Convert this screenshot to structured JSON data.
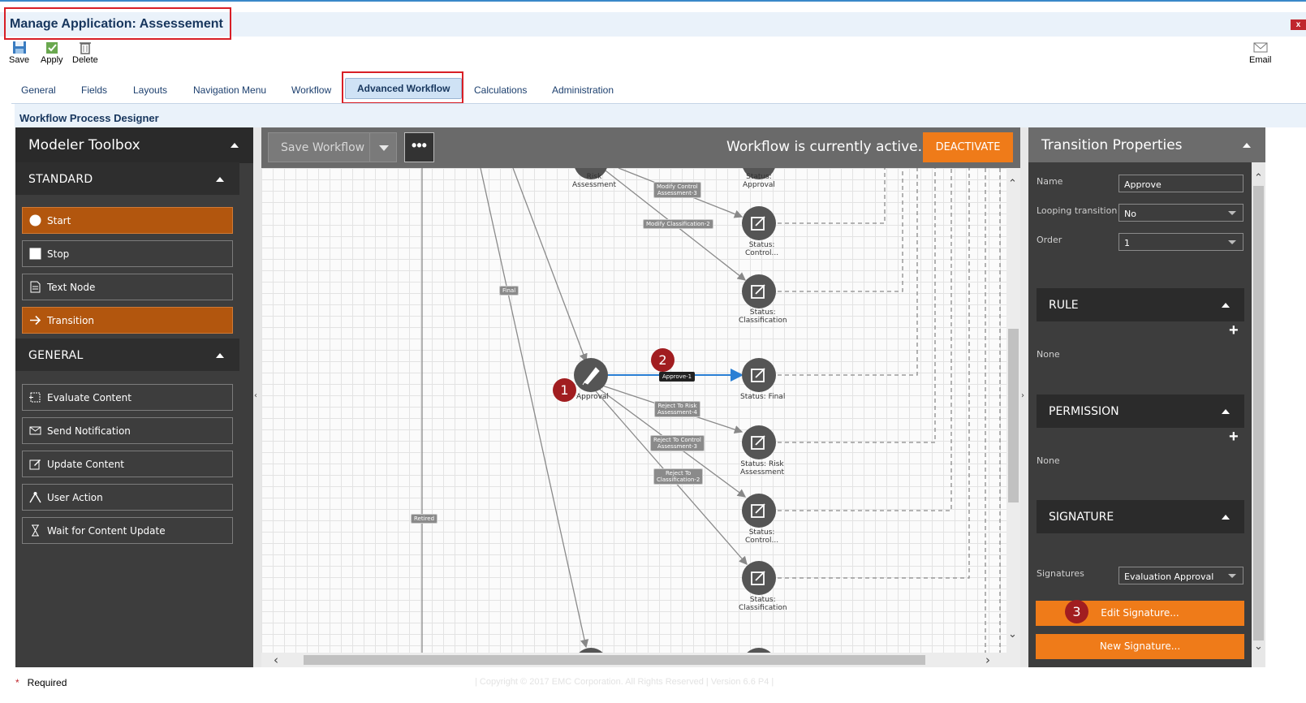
{
  "app": {
    "title": "Manage Application: Assessement",
    "close": "x"
  },
  "toolbar": {
    "save": "Save",
    "apply": "Apply",
    "delete": "Delete",
    "email": "Email"
  },
  "tabs": [
    {
      "label": "General"
    },
    {
      "label": "Fields"
    },
    {
      "label": "Layouts"
    },
    {
      "label": "Navigation Menu"
    },
    {
      "label": "Workflow"
    },
    {
      "label": "Advanced Workflow",
      "active": true
    },
    {
      "label": "Calculations"
    },
    {
      "label": "Administration"
    }
  ],
  "designer": {
    "title": "Workflow Process Designer"
  },
  "toolbox": {
    "title": "Modeler Toolbox",
    "standard": {
      "title": "STANDARD",
      "items": [
        {
          "label": "Start",
          "icon": "start-circle-icon"
        },
        {
          "label": "Stop",
          "icon": "stop-square-icon"
        },
        {
          "label": "Text Node",
          "icon": "text-node-icon"
        },
        {
          "label": "Transition",
          "icon": "arrow-right-icon"
        }
      ]
    },
    "general": {
      "title": "GENERAL",
      "items": [
        {
          "label": "Evaluate Content",
          "icon": "evaluate-icon"
        },
        {
          "label": "Send Notification",
          "icon": "envelope-icon"
        },
        {
          "label": "Update Content",
          "icon": "edit-icon"
        },
        {
          "label": "User Action",
          "icon": "user-action-icon"
        },
        {
          "label": "Wait for Content Update",
          "icon": "hourglass-icon"
        }
      ]
    }
  },
  "canvas": {
    "save_workflow": "Save Workflow",
    "more": "•••",
    "status_message": "Workflow is currently active.",
    "deactivate": "DEACTIVATE",
    "nodes": {
      "risk": "Risk\nAssessment",
      "status_approval": "Status:\nApproval",
      "status_control_1": "Status:\nControl...",
      "status_classification_1": "Status:\nClassification",
      "approval": "Approval",
      "status_final": "Status: Final",
      "status_risk": "Status: Risk\nAssessment",
      "status_control_2": "Status:\nControl...",
      "status_classification_2": "Status:\nClassification"
    },
    "edges": {
      "modify_control": "Modify Control\nAssessment-3",
      "modify_classification": "Modify Classification-2",
      "final": "Final",
      "approve": "Approve-1",
      "reject_risk": "Reject To Risk\nAssessment-4",
      "reject_control": "Reject To Control\nAssessment-3",
      "reject_class": "Reject To\nClassification-2",
      "retired": "Retired"
    },
    "badges": {
      "one": "1",
      "two": "2",
      "three": "3"
    }
  },
  "properties": {
    "title": "Transition Properties",
    "name_label": "Name",
    "name_value": "Approve",
    "looping_label": "Looping transition",
    "looping_value": "No",
    "order_label": "Order",
    "order_value": "1",
    "rule_title": "RULE",
    "rule_value": "None",
    "permission_title": "PERMISSION",
    "permission_value": "None",
    "signature_title": "SIGNATURE",
    "signatures_label": "Signatures",
    "signatures_value": "Evaluation Approval",
    "edit_signature": "Edit Signature...",
    "new_signature": "New Signature..."
  },
  "footer": {
    "required_star": "*",
    "required": "Required",
    "copyright": "|  Copyright © 2017 EMC Corporation.  All Rights Reserved  |  Version 6.6 P4  |"
  },
  "colors": {
    "accent": "#ef7b19",
    "brand": "#17365d",
    "highlight": "#d81f26",
    "badge": "#a11d20",
    "selected_edge": "#2a7fd4"
  }
}
